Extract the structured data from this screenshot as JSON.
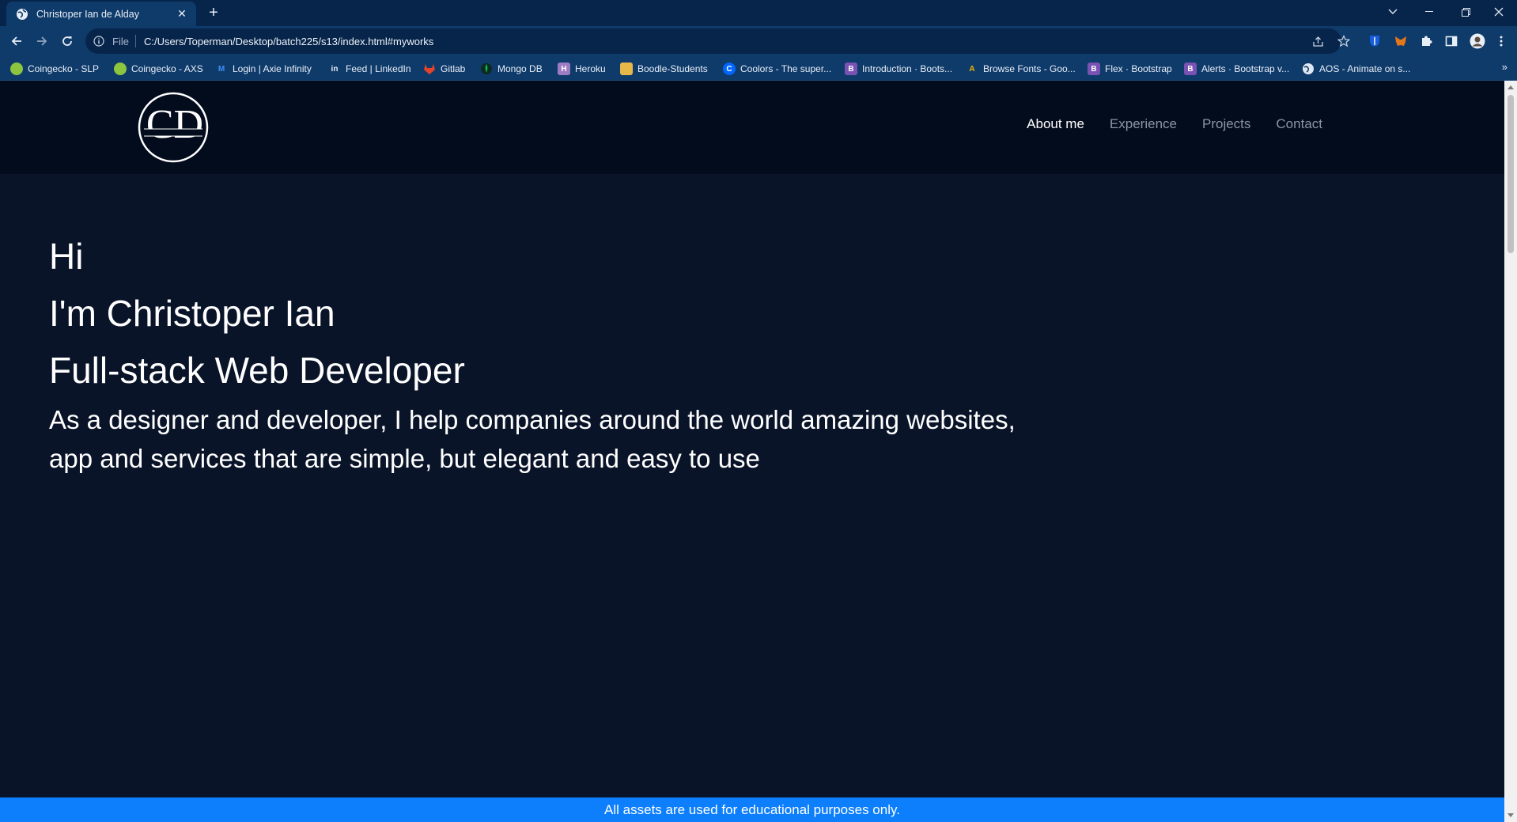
{
  "browser": {
    "tab": {
      "title": "Christoper Ian de Alday"
    },
    "address": {
      "scheme": "File",
      "url": "C:/Users/Toperman/Desktop/batch225/s13/index.html#myworks"
    },
    "bookmarks": [
      {
        "label": "Coingecko - SLP",
        "icon": "coingecko-icon",
        "color": "#8cc63f"
      },
      {
        "label": "Coingecko - AXS",
        "icon": "coingecko-icon",
        "color": "#8cc63f"
      },
      {
        "label": "Login | Axie Infinity",
        "icon": "axie-icon",
        "color": "#3d8df5"
      },
      {
        "label": "Feed | LinkedIn",
        "icon": "linkedin-icon",
        "color": "#0f3b6b"
      },
      {
        "label": "Gitlab",
        "icon": "gitlab-icon",
        "color": "#e24329"
      },
      {
        "label": "Mongo DB",
        "icon": "mongodb-icon",
        "color": "#13aa52"
      },
      {
        "label": "Heroku",
        "icon": "heroku-icon",
        "color": "#9e7cc1"
      },
      {
        "label": "Boodle-Students",
        "icon": "boodle-icon",
        "color": "#e6b84a"
      },
      {
        "label": "Coolors - The super...",
        "icon": "coolors-icon",
        "color": "#0066ff"
      },
      {
        "label": "Introduction · Boots...",
        "icon": "bootstrap-icon",
        "color": "#7952b3"
      },
      {
        "label": "Browse Fonts - Goo...",
        "icon": "google-fonts-icon",
        "color": "#f4b400"
      },
      {
        "label": "Flex · Bootstrap",
        "icon": "bootstrap-icon",
        "color": "#7952b3"
      },
      {
        "label": "Alerts · Bootstrap v...",
        "icon": "bootstrap-icon",
        "color": "#7952b3"
      },
      {
        "label": "AOS - Animate on s...",
        "icon": "globe-icon",
        "color": "#dfe7f1"
      }
    ]
  },
  "site": {
    "logo": {
      "initials": "CD",
      "name": "Christoper Ian de Alday"
    },
    "nav": [
      {
        "label": "About me",
        "active": true
      },
      {
        "label": "Experience",
        "active": false
      },
      {
        "label": "Projects",
        "active": false
      },
      {
        "label": "Contact",
        "active": false
      }
    ],
    "hero": {
      "greeting": "Hi",
      "intro": "I'm Christoper Ian",
      "role": "Full-stack Web Developer",
      "description": "As a designer and developer, I help companies around the world amazing websites, app and services that are simple, but elegant and easy to use"
    },
    "footer": {
      "text": "All assets are used for educational purposes only."
    }
  },
  "colors": {
    "page_bg": "#0a1429",
    "nav_bg": "#030c1d",
    "footer_bg": "#0d7ffd",
    "chrome_bg": "#0f3b6b"
  }
}
